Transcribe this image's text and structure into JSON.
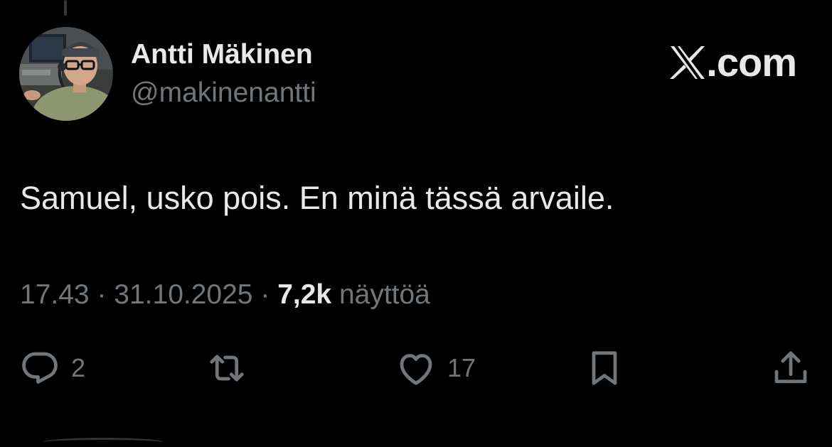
{
  "author": {
    "display_name": "Antti Mäkinen",
    "handle": "@makinenantti"
  },
  "brand": {
    "logo_icon": "x-logo-icon",
    "label": ".com"
  },
  "tweet": {
    "text": "Samuel, usko pois. En minä tässä arvaile."
  },
  "meta": {
    "time": "17.43",
    "separator": "·",
    "date": "31.10.2025",
    "views_count": "7,2k",
    "views_label": "näyttöä"
  },
  "actions": {
    "reply": {
      "icon": "reply-icon",
      "count": "2"
    },
    "repost": {
      "icon": "repost-icon",
      "count": ""
    },
    "like": {
      "icon": "heart-icon",
      "count": "17"
    },
    "bookmark": {
      "icon": "bookmark-icon"
    },
    "share": {
      "icon": "share-icon"
    }
  },
  "colors": {
    "background": "#000000",
    "primary_text": "#e7e9ea",
    "secondary_text": "#71767b"
  }
}
